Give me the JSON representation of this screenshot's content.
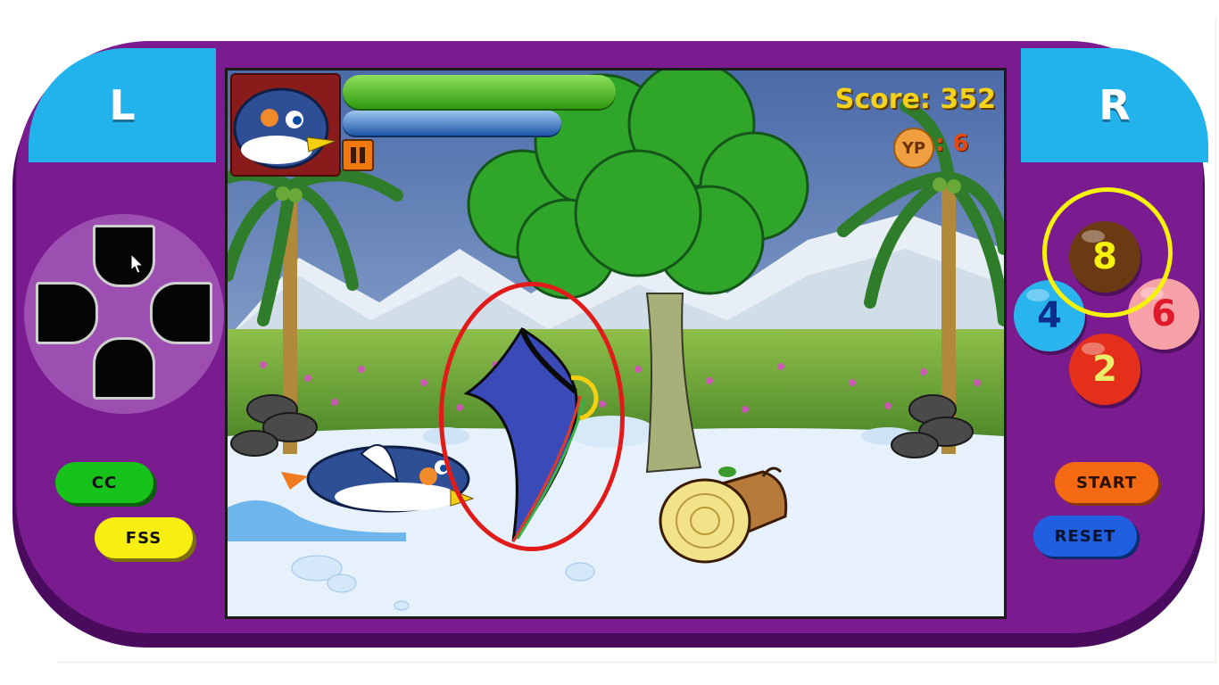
{
  "console": {
    "shoulder_left": "L",
    "shoulder_right": "R",
    "cc_label": "CC",
    "fss_label": "FSS",
    "start_label": "START",
    "reset_label": "RESET",
    "face_buttons": {
      "top": "8",
      "left": "4",
      "right": "6",
      "bottom": "2"
    }
  },
  "hud": {
    "score_text": "Score: 352",
    "yp_icon_label": "YP",
    "yp_value": ": 6",
    "health_level_percent": 100,
    "energy_level_percent": 80
  },
  "colors": {
    "console_purple": "#7a1b8f",
    "shoulder_blue": "#23b3ec",
    "highlight_yellow": "#f7f20a",
    "highlight_red": "#e11a1a"
  },
  "icons": {
    "pause": "pause-icon",
    "dpad": "dpad-icon",
    "mouse_cursor": "mouse-cursor-icon",
    "coin": "yp-coin-icon"
  }
}
